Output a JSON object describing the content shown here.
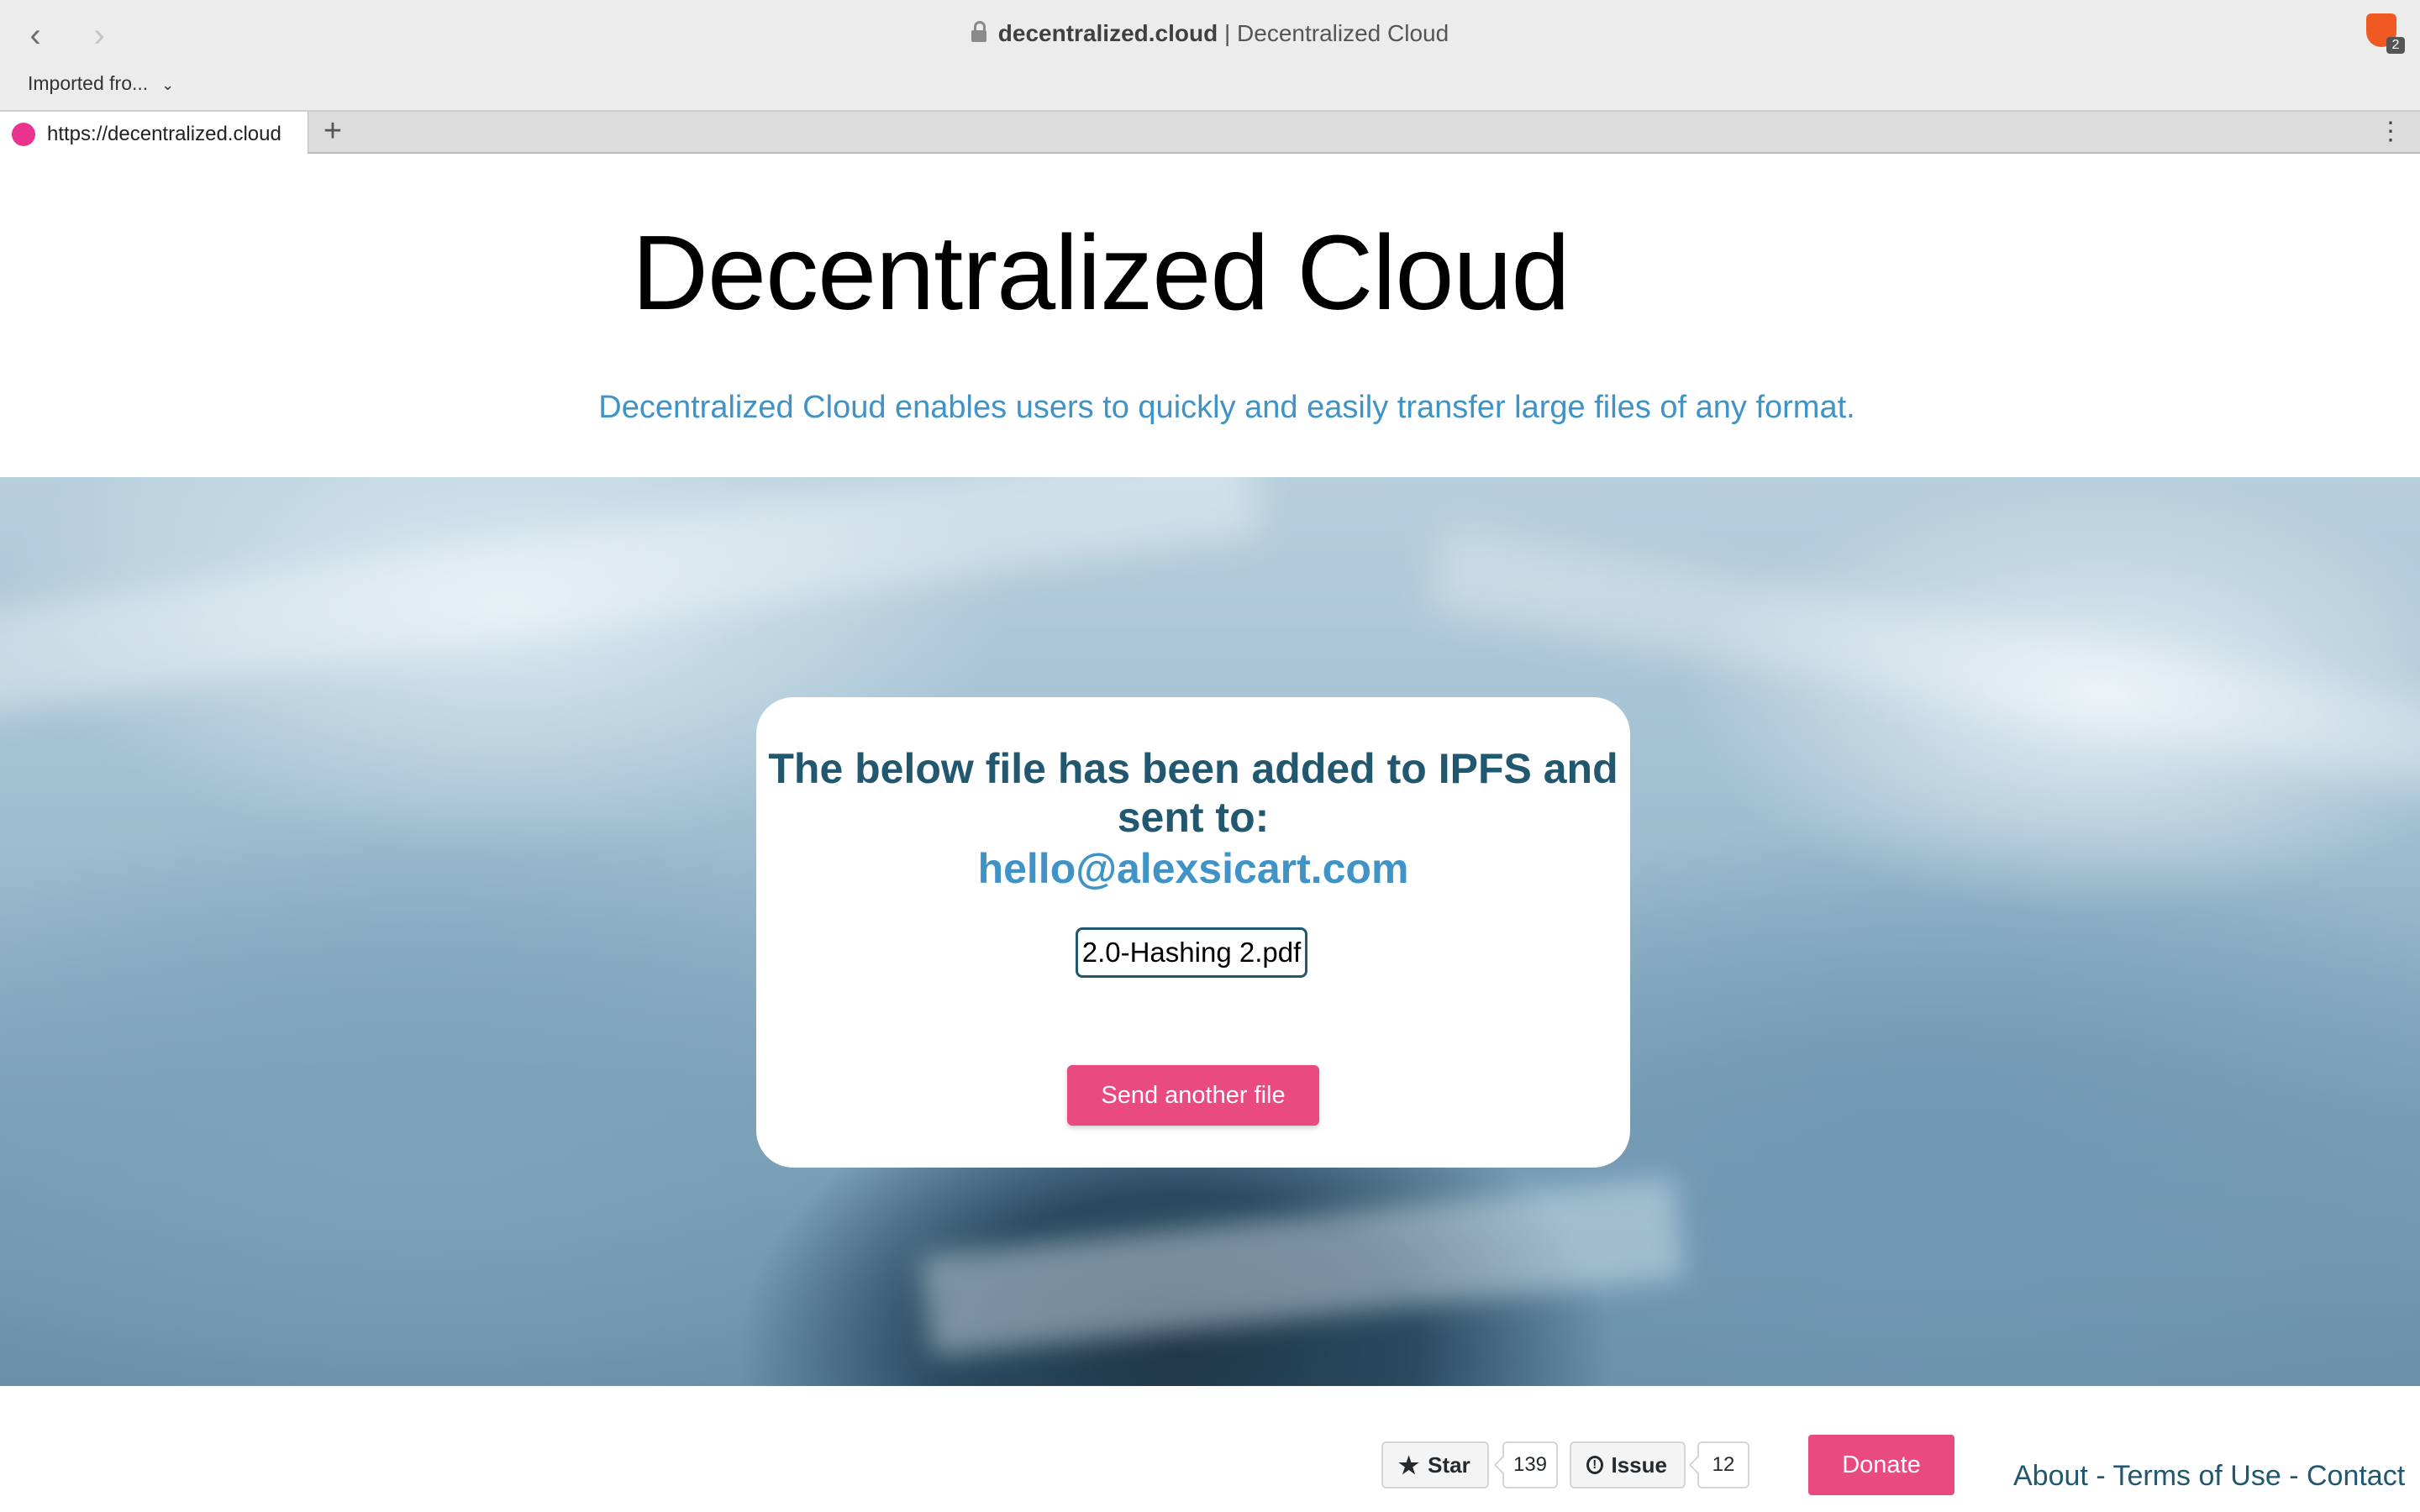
{
  "browser": {
    "host": "decentralized.cloud",
    "title_separator": "|",
    "page_title": "Decentralized Cloud",
    "bookmark_label": "Imported fro...",
    "tab_url": "https://decentralized.cloud",
    "extension_badge": "2"
  },
  "page": {
    "title": "Decentralized Cloud",
    "subtitle": "Decentralized Cloud enables users to quickly and easily transfer large files of any format."
  },
  "card": {
    "heading_line1": "The below file has been added to IPFS and",
    "heading_line2": "sent to:",
    "email": "hello@alexsicart.com",
    "file_name": "2.0-Hashing 2.pdf",
    "send_button": "Send another file"
  },
  "footer": {
    "star_label": "Star",
    "star_count": "139",
    "issue_label": "Issue",
    "issue_count": "12",
    "donate_label": "Donate",
    "link_about": "About",
    "link_terms": "Terms of Use",
    "link_contact": "Contact",
    "separator": "-"
  },
  "colors": {
    "accent_blue": "#3f93c6",
    "dark_teal": "#22586f",
    "pink_button": "#e94a7f"
  }
}
